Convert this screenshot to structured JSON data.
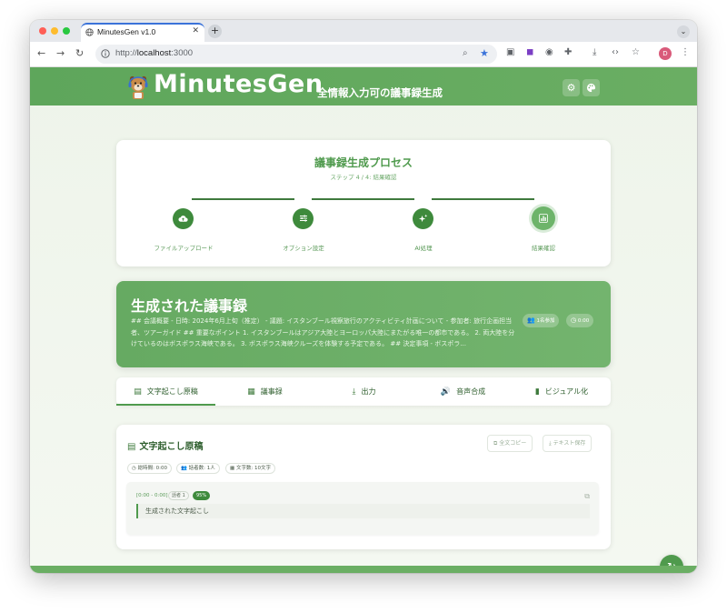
{
  "browser": {
    "tab_title": "MinutesGen v1.0",
    "url_prefix": "http://",
    "url_host": "localhost",
    "url_suffix": ":3000",
    "avatar_letter": "D"
  },
  "header": {
    "app_name": "MinutesGen",
    "tagline": "全情報入力可の議事録生成"
  },
  "process": {
    "title": "議事録生成プロセス",
    "step_text": "ステップ 4 / 4: 結果確認",
    "steps": [
      {
        "label": "ファイルアップロード",
        "icon": "cloud-upload-icon"
      },
      {
        "label": "オプション設定",
        "icon": "sliders-icon"
      },
      {
        "label": "AI処理",
        "icon": "sparkle-icon"
      },
      {
        "label": "結果確認",
        "icon": "bar-chart-icon"
      }
    ]
  },
  "result": {
    "title": "生成された議事録",
    "summary": "## 会議概要 - 日時: 2024年6月上旬（推定） - 議題: イスタンブール視察旅行のアクティビティ計画について - 参加者: 旅行企画担当者、ツアーガイド ## 重要なポイント 1. イスタンブールはアジア大陸とヨーロッパ大陸にまたがる唯一の都市である。 2. 両大陸を分けているのはボスポラス海峡である。 3. ボスポラス海峡クルーズを体験する予定である。 ## 決定事項 - ボスポラ...",
    "participants": "1名参加",
    "duration": "0:00"
  },
  "tabs": [
    {
      "label": "文字起こし原稿",
      "icon": "document-icon"
    },
    {
      "label": "議事録",
      "icon": "file-icon"
    },
    {
      "label": "出力",
      "icon": "download-icon"
    },
    {
      "label": "音声合成",
      "icon": "voice-icon"
    },
    {
      "label": "ビジュアル化",
      "icon": "bar-chart-icon"
    }
  ],
  "transcript": {
    "title": "文字起こし原稿",
    "copy_all": "全文コピー",
    "save_text": "テキスト保存",
    "meta_time": "総時間: 0:00",
    "meta_speakers": "話者数: 1人",
    "meta_chars": "文字数: 10文字",
    "segment": {
      "time": "[0:00 - 0:00]",
      "speaker": "話者 1",
      "confidence": "95%",
      "text": "生成された文字起こし"
    }
  },
  "colors": {
    "primary": "#4f9a4d",
    "header": "#5ea65b",
    "step_dark": "#3e8a3c",
    "step_active": "#6db46a"
  }
}
